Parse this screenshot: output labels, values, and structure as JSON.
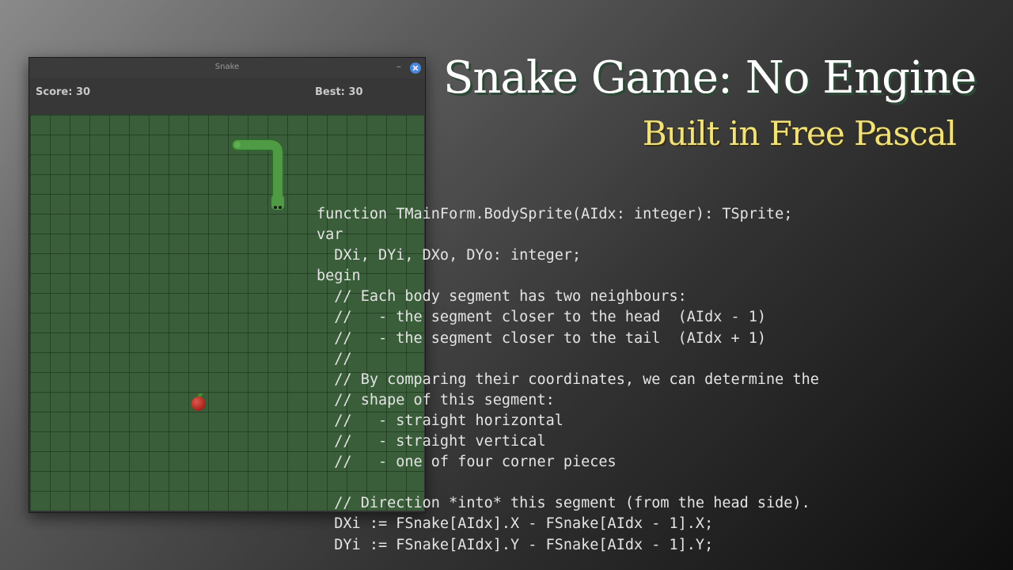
{
  "window": {
    "title": "Snake",
    "minimize_glyph": "–",
    "close_icon": "close-icon",
    "accent_color": "#4a86d8"
  },
  "scorebar": {
    "score": "Score: 30",
    "best": "Best: 30"
  },
  "board": {
    "grid": "20x20",
    "background_color": "#3a5e3a",
    "snake_color": "#4f9a45",
    "apple_color": "#c0362c"
  },
  "heading": {
    "title": "Snake Game: No Engine",
    "subtitle": "Built in Free Pascal",
    "title_color": "#ffffff",
    "subtitle_color": "#f1e27a"
  },
  "code": {
    "lines": [
      "function TMainForm.BodySprite(AIdx: integer): TSprite;",
      "var",
      "  DXi, DYi, DXo, DYo: integer;",
      "begin",
      "  // Each body segment has two neighbours:",
      "  //   - the segment closer to the head  (AIdx - 1)",
      "  //   - the segment closer to the tail  (AIdx + 1)",
      "  //",
      "  // By comparing their coordinates, we can determine the",
      "  // shape of this segment:",
      "  //   - straight horizontal",
      "  //   - straight vertical",
      "  //   - one of four corner pieces",
      "",
      "  // Direction *into* this segment (from the head side).",
      "  DXi := FSnake[AIdx].X - FSnake[AIdx - 1].X;",
      "  DYi := FSnake[AIdx].Y - FSnake[AIdx - 1].Y;"
    ]
  }
}
